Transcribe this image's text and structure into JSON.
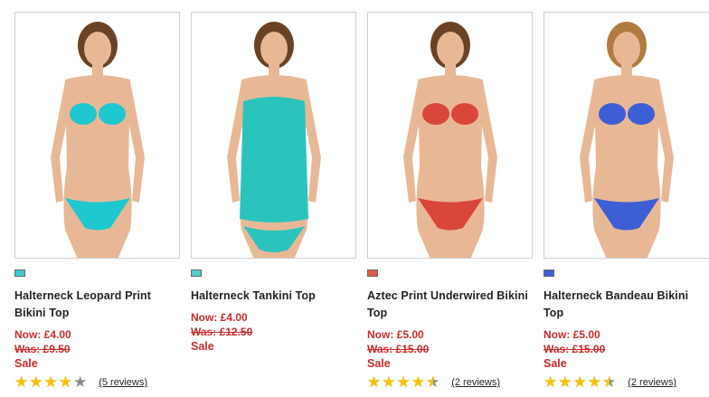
{
  "products": [
    {
      "title": "Halterneck Leopard Print Bikini Top",
      "price_now": "Now: £4.00",
      "price_was": "Was: £9.50",
      "sale_label": "Sale",
      "rating": 0.8,
      "reviews": "(5 reviews)",
      "swatch_color": "#3fc8d0",
      "swim_color": "#1fc7cf",
      "model": "model-1-image"
    },
    {
      "title": "Halterneck Tankini Top",
      "price_now": "Now: £4.00",
      "price_was": "Was: £12.50",
      "sale_label": "Sale",
      "rating": null,
      "reviews": "",
      "swatch_color": "#4fcfc8",
      "swim_color": "#2bc4bd",
      "model": "model-2-image"
    },
    {
      "title": "Aztec Print Underwired Bikini Top",
      "price_now": "Now: £5.00",
      "price_was": "Was: £15.00",
      "sale_label": "Sale",
      "rating": 0.9,
      "reviews": "(2 reviews)",
      "swatch_color": "#e05a4a",
      "swim_color": "#d9463a",
      "model": "model-3-image"
    },
    {
      "title": "Halterneck Bandeau Bikini Top",
      "price_now": "Now: £5.00",
      "price_was": "Was: £15.00",
      "sale_label": "Sale",
      "rating": 0.9,
      "reviews": "(2 reviews)",
      "swatch_color": "#3a5fd8",
      "swim_color": "#3e5ed6",
      "model": "model-4-image"
    }
  ],
  "star_icon": "star-icon",
  "colors": {
    "price": "#cc2a2a",
    "star": "#f5c400",
    "star_empty": "#8a8a8a"
  }
}
